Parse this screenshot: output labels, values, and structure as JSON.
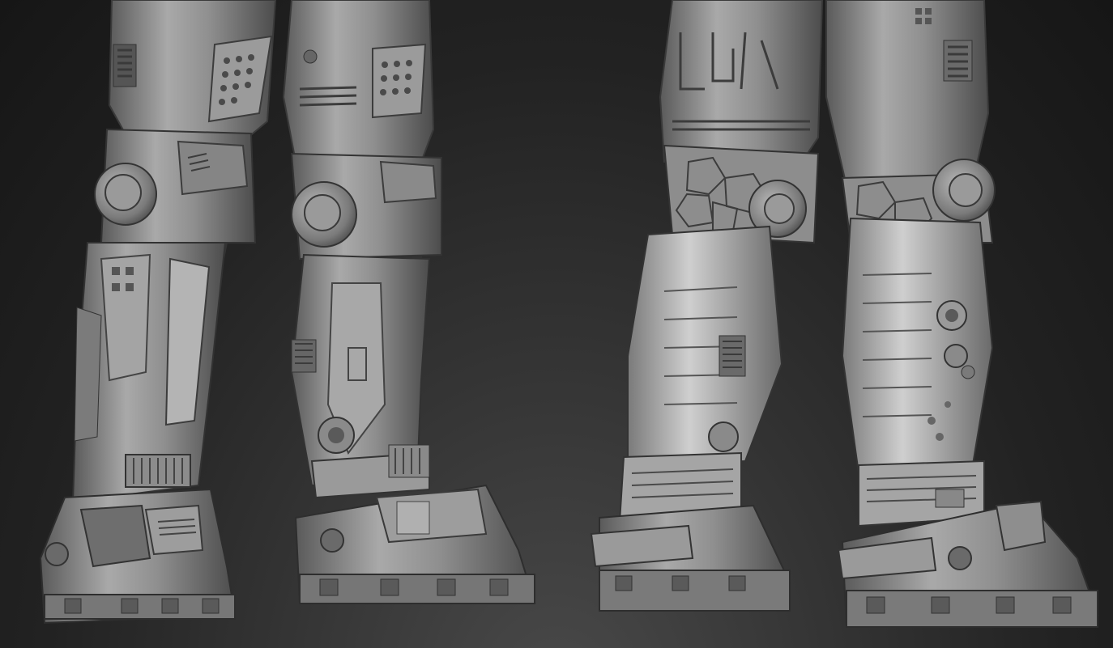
{
  "scene": {
    "subject": "mech-armor-legs-sculpt",
    "views": [
      "front-view",
      "rear-view"
    ],
    "material": "matcap-gray",
    "colors": {
      "background_center": "#4a4a4a",
      "background_edge": "#161616",
      "clay_light": "#bdbdbd",
      "clay_mid": "#8e8e8e",
      "clay_dark": "#4e4e4e",
      "clay_shadow": "#2c2c2c"
    }
  }
}
